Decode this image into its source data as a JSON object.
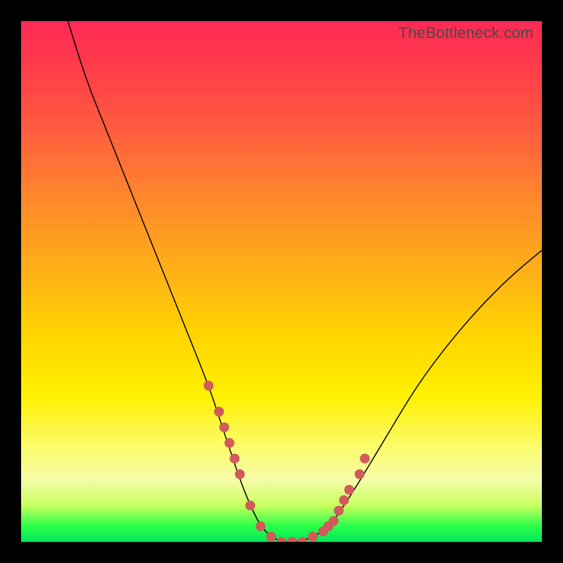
{
  "watermark": "TheBottleneck.com",
  "colors": {
    "frame": "#000000",
    "curve": "#000000",
    "marker": "#d15a5a",
    "gradient_stops": [
      "#ff2a55",
      "#ff5a40",
      "#ffb018",
      "#fff000",
      "#f6fca8",
      "#2aff4a",
      "#00e85a"
    ]
  },
  "chart_data": {
    "type": "line",
    "title": "",
    "xlabel": "",
    "ylabel": "",
    "xlim": [
      0,
      100
    ],
    "ylim": [
      0,
      100
    ],
    "grid": false,
    "series": [
      {
        "name": "bottleneck-curve",
        "x": [
          9,
          12,
          16,
          20,
          24,
          28,
          32,
          36,
          38,
          40,
          42,
          44,
          46,
          48,
          50,
          54,
          58,
          60,
          64,
          70,
          76,
          82,
          88,
          94,
          100
        ],
        "y": [
          100,
          90,
          80,
          70,
          60,
          50,
          40,
          30,
          24,
          18,
          12,
          7,
          3,
          1,
          0,
          0,
          2,
          4,
          10,
          20,
          30,
          38,
          45,
          51,
          56
        ]
      }
    ],
    "markers": {
      "name": "highlighted-points",
      "x": [
        36,
        38,
        39,
        40,
        41,
        42,
        44,
        46,
        48,
        50,
        52,
        54,
        56,
        58,
        59,
        60,
        61,
        62,
        63,
        65,
        66
      ],
      "y": [
        30,
        25,
        22,
        19,
        16,
        13,
        7,
        3,
        1,
        0,
        0,
        0,
        1,
        2,
        3,
        4,
        6,
        8,
        10,
        13,
        16
      ]
    }
  }
}
